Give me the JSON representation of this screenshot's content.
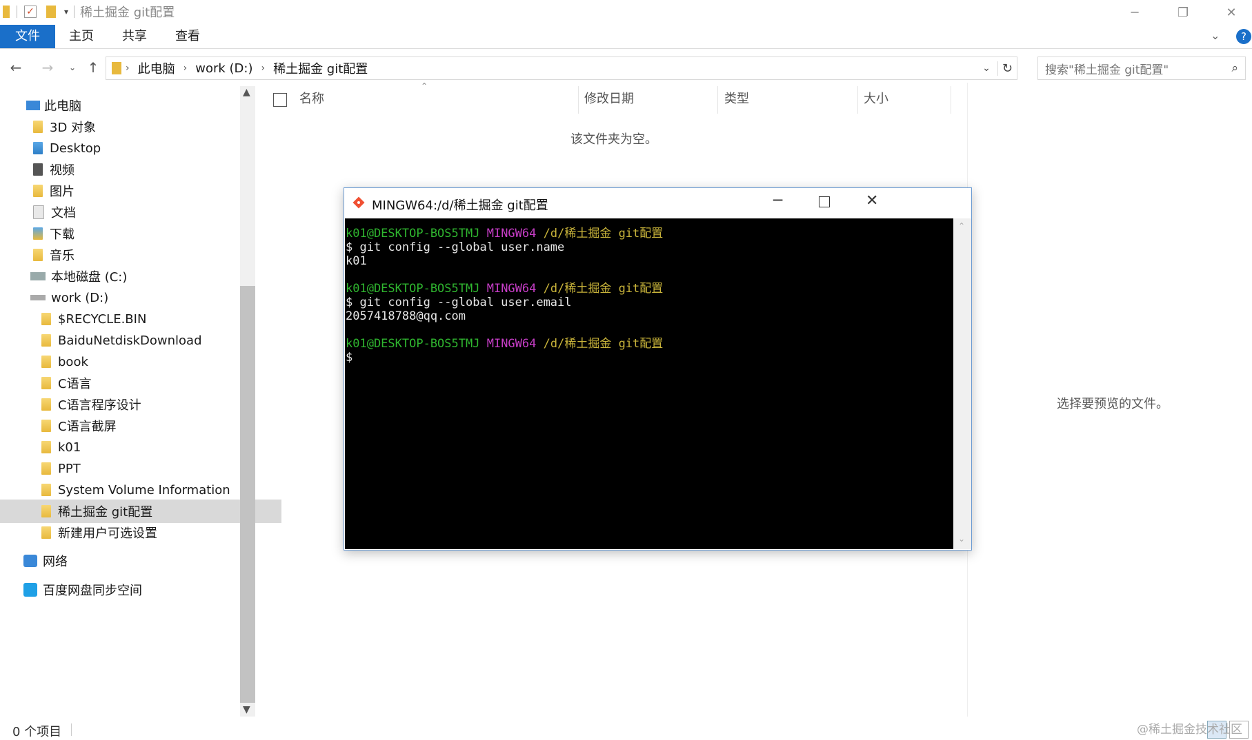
{
  "window": {
    "title": "稀土掘金 git配置"
  },
  "ribbon": {
    "tabs": [
      "文件",
      "主页",
      "共享",
      "查看"
    ]
  },
  "address": {
    "crumbs": [
      "此电脑",
      "work (D:)",
      "稀土掘金 git配置"
    ],
    "search_placeholder": "搜索\"稀土掘金 git配置\""
  },
  "nav": {
    "items": [
      {
        "label": "此电脑",
        "icon": "computer-icon"
      },
      {
        "label": "3D 对象",
        "icon": "3d-objects-icon"
      },
      {
        "label": "Desktop",
        "icon": "desktop-folder-icon"
      },
      {
        "label": "视频",
        "icon": "video-folder-icon"
      },
      {
        "label": "图片",
        "icon": "pictures-folder-icon"
      },
      {
        "label": "文档",
        "icon": "documents-folder-icon"
      },
      {
        "label": "下载",
        "icon": "downloads-folder-icon"
      },
      {
        "label": "音乐",
        "icon": "music-folder-icon"
      },
      {
        "label": "本地磁盘 (C:)",
        "icon": "drive-icon"
      },
      {
        "label": "work (D:)",
        "icon": "drive-icon"
      },
      {
        "label": "$RECYCLE.BIN",
        "icon": "folder-icon"
      },
      {
        "label": "BaiduNetdiskDownload",
        "icon": "folder-icon"
      },
      {
        "label": "book",
        "icon": "folder-icon"
      },
      {
        "label": "C语言",
        "icon": "folder-icon"
      },
      {
        "label": "C语言程序设计",
        "icon": "folder-icon"
      },
      {
        "label": "C语言截屏",
        "icon": "folder-icon"
      },
      {
        "label": "k01",
        "icon": "folder-icon"
      },
      {
        "label": "PPT",
        "icon": "folder-icon"
      },
      {
        "label": "System Volume Information",
        "icon": "folder-icon"
      },
      {
        "label": "稀土掘金 git配置",
        "icon": "folder-icon"
      },
      {
        "label": "新建用户可选设置",
        "icon": "folder-icon"
      },
      {
        "label": "网络",
        "icon": "network-icon"
      },
      {
        "label": "百度网盘同步空间",
        "icon": "baidu-cloud-icon"
      }
    ]
  },
  "content": {
    "columns": [
      "名称",
      "修改日期",
      "类型",
      "大小"
    ],
    "empty_text": "该文件夹为空。",
    "preview_text": "选择要预览的文件。"
  },
  "status": {
    "count": "0 个项目"
  },
  "terminal": {
    "title": "MINGW64:/d/稀土掘金 git配置",
    "prompt_user": "k01@DESKTOP-BOS5TMJ",
    "prompt_env": "MINGW64",
    "prompt_path": "/d/稀土掘金 git配置",
    "cmd1": "$ git config --global user.name",
    "out1": "k01",
    "cmd2": "$ git config --global user.email",
    "out2": "2057418788@qq.com",
    "cmd3": "$"
  },
  "watermark": "@稀土掘金技术社区",
  "colors": {
    "file_tab": "#1a6fc9",
    "prompt_green": "#2fb52f",
    "prompt_magenta": "#c53dc5",
    "prompt_yellow": "#c8b33a"
  }
}
